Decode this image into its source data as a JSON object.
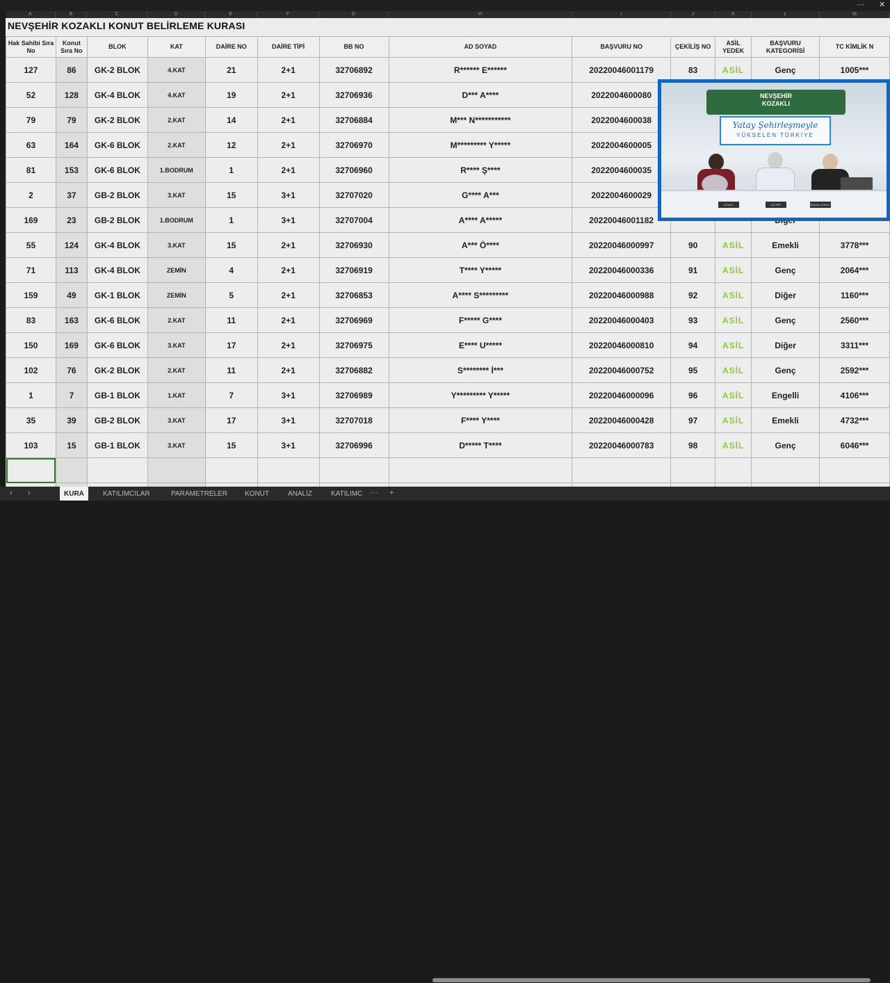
{
  "window": {
    "menu_label": "···",
    "close_label": "✕"
  },
  "sheet": {
    "title": "NEVŞEHİR KOZAKLI KONUT BELİRLEME KURASI",
    "col_letters": [
      "A",
      "B",
      "C",
      "D",
      "E",
      "F",
      "G",
      "H",
      "I",
      "J",
      "K",
      "L",
      "M"
    ],
    "headers": [
      "Hak Sahibi Sıra No",
      "Konut Sıra No",
      "BLOK",
      "KAT",
      "DAİRE NO",
      "DAİRE TİPİ",
      "BB NO",
      "AD SOYAD",
      "BAŞVURU NO",
      "ÇEKİLİŞ NO",
      "ASİL YEDEK",
      "BAŞVURU KATEGORİSİ",
      "TC KİMLİK N"
    ],
    "rows": [
      [
        "127",
        "86",
        "GK-2 BLOK",
        "4.KAT",
        "21",
        "2+1",
        "32706892",
        "R****** E******",
        "20220046001179",
        "83",
        "ASİL",
        "Genç",
        "1005***"
      ],
      [
        "52",
        "128",
        "GK-4 BLOK",
        "4.KAT",
        "19",
        "2+1",
        "32706936",
        "D*** A****",
        "2022004600080",
        "",
        "",
        "",
        ""
      ],
      [
        "79",
        "79",
        "GK-2 BLOK",
        "2.KAT",
        "14",
        "2+1",
        "32706884",
        "M*** N***********",
        "2022004600038",
        "",
        "",
        "",
        ""
      ],
      [
        "63",
        "164",
        "GK-6 BLOK",
        "2.KAT",
        "12",
        "2+1",
        "32706970",
        "M********* Y*****",
        "2022004600005",
        "",
        "",
        "",
        ""
      ],
      [
        "81",
        "153",
        "GK-6 BLOK",
        "1.BODRUM",
        "1",
        "2+1",
        "32706960",
        "R**** Ş****",
        "2022004600035",
        "",
        "",
        "",
        ""
      ],
      [
        "2",
        "37",
        "GB-2 BLOK",
        "3.KAT",
        "15",
        "3+1",
        "32707020",
        "G**** A***",
        "2022004600029",
        "",
        "",
        "",
        ""
      ],
      [
        "169",
        "23",
        "GB-2 BLOK",
        "1.BODRUM",
        "1",
        "3+1",
        "32707004",
        "A**** A*****",
        "20220046001182",
        "",
        "",
        "Diğer",
        ""
      ],
      [
        "55",
        "124",
        "GK-4 BLOK",
        "3.KAT",
        "15",
        "2+1",
        "32706930",
        "A*** Ö****",
        "20220046000997",
        "90",
        "ASİL",
        "Emekli",
        "3778***"
      ],
      [
        "71",
        "113",
        "GK-4 BLOK",
        "ZEMİN",
        "4",
        "2+1",
        "32706919",
        "T**** Y*****",
        "20220046000336",
        "91",
        "ASİL",
        "Genç",
        "2064***"
      ],
      [
        "159",
        "49",
        "GK-1 BLOK",
        "ZEMİN",
        "5",
        "2+1",
        "32706853",
        "A**** S*********",
        "20220046000988",
        "92",
        "ASİL",
        "Diğer",
        "1160***"
      ],
      [
        "83",
        "163",
        "GK-6 BLOK",
        "2.KAT",
        "11",
        "2+1",
        "32706969",
        "F***** G****",
        "20220046000403",
        "93",
        "ASİL",
        "Genç",
        "2560***"
      ],
      [
        "150",
        "169",
        "GK-6 BLOK",
        "3.KAT",
        "17",
        "2+1",
        "32706975",
        "E**** U*****",
        "20220046000810",
        "94",
        "ASİL",
        "Diğer",
        "3311***"
      ],
      [
        "102",
        "76",
        "GK-2 BLOK",
        "2.KAT",
        "11",
        "2+1",
        "32706882",
        "S******** İ***",
        "20220046000752",
        "95",
        "ASİL",
        "Genç",
        "2592***"
      ],
      [
        "1",
        "7",
        "GB-1 BLOK",
        "1.KAT",
        "7",
        "3+1",
        "32706989",
        "Y********* Y*****",
        "20220046000096",
        "96",
        "ASİL",
        "Engelli",
        "4106***"
      ],
      [
        "35",
        "39",
        "GB-2 BLOK",
        "3.KAT",
        "17",
        "3+1",
        "32707018",
        "F**** Y****",
        "20220046000428",
        "97",
        "ASİL",
        "Emekli",
        "4732***"
      ],
      [
        "103",
        "15",
        "GB-1 BLOK",
        "3.KAT",
        "15",
        "3+1",
        "32706996",
        "D***** T****",
        "20220046000783",
        "98",
        "ASİL",
        "Genç",
        "6046***"
      ]
    ]
  },
  "tabs": {
    "nav_prev": "‹",
    "nav_next": "›",
    "items": [
      "KURA",
      "KATILIMCILAR",
      "PARAMETRELER",
      "KONUT",
      "ANALİZ",
      "KATILIMC"
    ],
    "more": "···",
    "add": "+",
    "active": "KURA"
  },
  "video": {
    "banner_line1": "NEVŞEHİR",
    "banner_line2": "KOZAKLI",
    "slogan_main": "Yatay Şehirleşmeyle",
    "slogan_sub": "YÜKSELEN TÜRKİYE",
    "plate1": "KONUT",
    "plate2": "NOTER",
    "plate3": "EMLAK KONUT"
  }
}
